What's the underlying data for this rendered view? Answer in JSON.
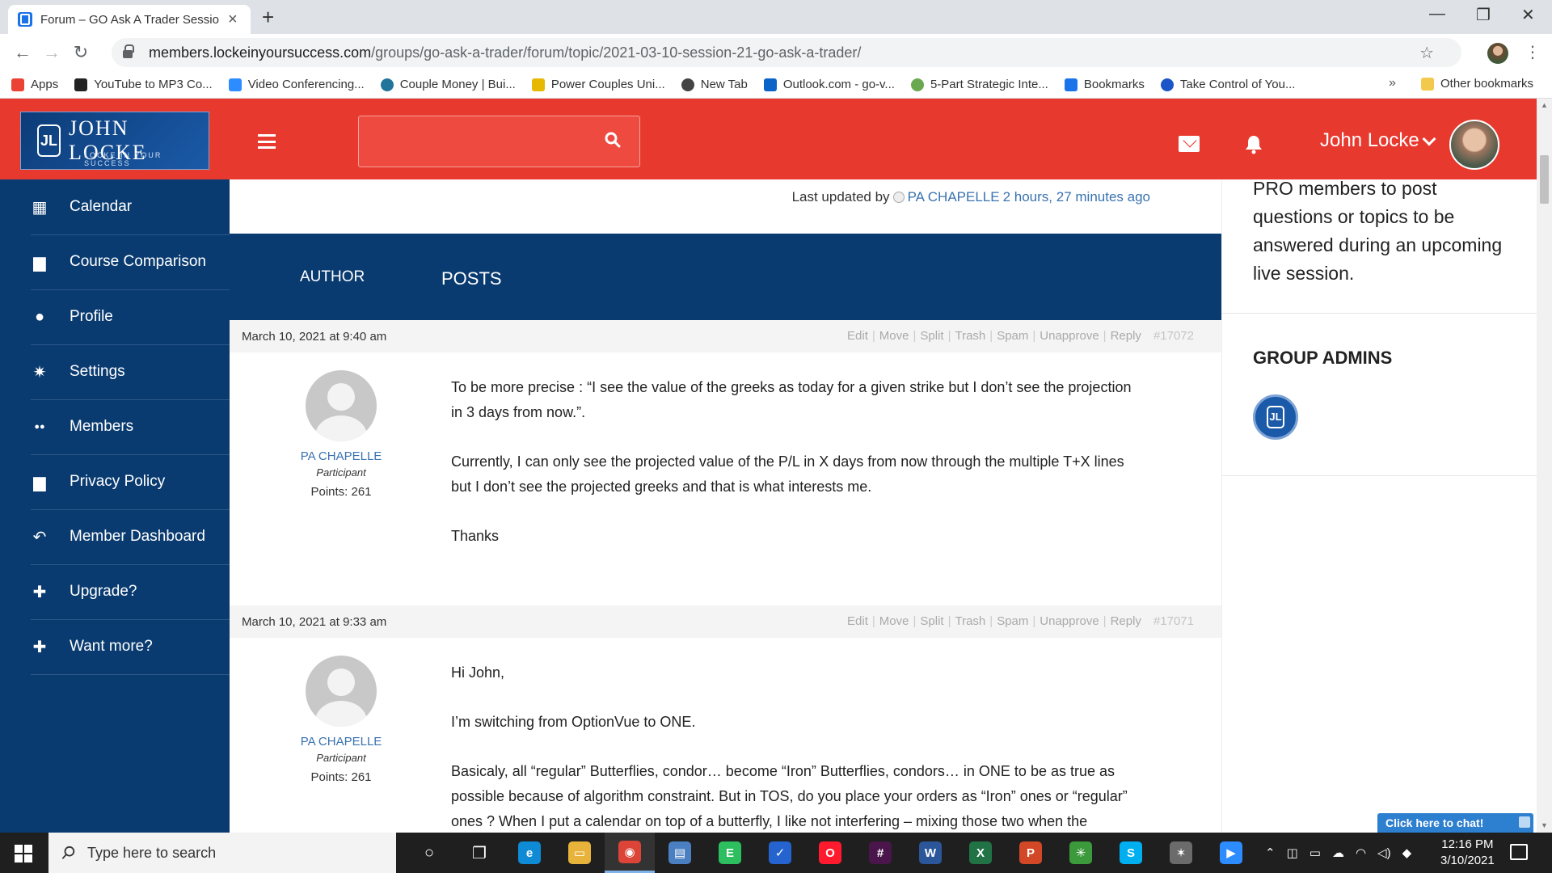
{
  "browser": {
    "tab_title": "Forum – GO Ask A Trader Sessio",
    "url_host": "members.lockeinyoursuccess.com",
    "url_path": "/groups/go-ask-a-trader/forum/topic/2021-03-10-session-21-go-ask-a-trader/",
    "bookmarks": [
      {
        "label": "Apps",
        "icon": "apps-grid-icon",
        "color": "#ea4335"
      },
      {
        "label": "YouTube to MP3 Co...",
        "icon": "music-note-icon",
        "color": "#222222"
      },
      {
        "label": "Video Conferencing...",
        "icon": "zoom-icon",
        "color": "#2d8cff"
      },
      {
        "label": "Couple Money | Bui...",
        "icon": "wordpress-icon",
        "color": "#21759b"
      },
      {
        "label": "Power Couples Uni...",
        "icon": "bookmark-page-icon",
        "color": "#e6b800"
      },
      {
        "label": "New Tab",
        "icon": "globe-icon",
        "color": "#444444"
      },
      {
        "label": "Outlook.com - go-v...",
        "icon": "outlook-icon",
        "color": "#0a64c8"
      },
      {
        "label": "5-Part Strategic Inte...",
        "icon": "circle-logo-icon",
        "color": "#6aa84f"
      },
      {
        "label": "Bookmarks",
        "icon": "star-icon",
        "color": "#1a73e8"
      },
      {
        "label": "Take Control of You...",
        "icon": "swirl-logo-icon",
        "color": "#1a56c8"
      }
    ],
    "more_label": "»",
    "other_bookmarks": "Other bookmarks"
  },
  "header": {
    "logo_text": "JOHN LOCKE",
    "logo_tagline": "LOCKE IN YOUR SUCCESS",
    "user_name": "John Locke",
    "brand_color": "#e8392f"
  },
  "sidebar": {
    "items": [
      {
        "label": "Calendar",
        "icon": "calendar-icon"
      },
      {
        "label": "Course Comparison",
        "icon": "document-icon"
      },
      {
        "label": "Profile",
        "icon": "person-icon"
      },
      {
        "label": "Settings",
        "icon": "gears-icon"
      },
      {
        "label": "Members",
        "icon": "group-icon"
      },
      {
        "label": "Privacy Policy",
        "icon": "document-icon"
      },
      {
        "label": "Member Dashboard",
        "icon": "reply-arrow-icon"
      },
      {
        "label": "Upgrade?",
        "icon": "plus-icon"
      },
      {
        "label": "Want more?",
        "icon": "plus-icon"
      }
    ]
  },
  "topic": {
    "last_updated_prefix": "Last updated by",
    "last_updated_user": "PA CHAPELLE",
    "last_updated_time": "2 hours, 27 minutes ago",
    "col_author": "AUTHOR",
    "col_posts": "POSTS"
  },
  "post_actions": [
    "Edit",
    "Move",
    "Split",
    "Trash",
    "Spam",
    "Unapprove",
    "Reply"
  ],
  "posts": [
    {
      "date": "March 10, 2021 at 9:40 am",
      "id": "#17072",
      "author": "PA CHAPELLE",
      "role": "Participant",
      "points": "Points: 261",
      "paragraphs": [
        "To be more precise : “I see the value of the greeks as today for a given strike but I don’t see the projection in 3 days from now.”.",
        "Currently, I can only see the projected value of the P/L in X days from now through the multiple T+X lines but I don’t see the projected greeks and that is what interests me.",
        "Thanks"
      ]
    },
    {
      "date": "March 10, 2021 at 9:33 am",
      "id": "#17071",
      "author": "PA CHAPELLE",
      "role": "Participant",
      "points": "Points: 261",
      "paragraphs": [
        "Hi John,",
        "I’m switching from OptionVue to ONE.",
        "Basicaly, all “regular” Butterflies, condor… become “Iron” Butterflies, condors… in ONE to be as true as possible because of algorithm constraint. But in TOS, do you place your orders as “Iron” ones or “regular” ones ? When I put a calendar on top of a butterfly, I like not interfering – mixing those two when the"
      ]
    }
  ],
  "right_panel": {
    "intro_text": "PRO members to post questions or topics to be answered during an upcoming live session.",
    "admins_heading": "GROUP ADMINS"
  },
  "chat": {
    "label": "Click here to chat!"
  },
  "taskbar": {
    "search_placeholder": "Type here to search",
    "apps": [
      {
        "name": "cortana-icon",
        "color": "#1f1f1f",
        "glyph": "○"
      },
      {
        "name": "task-view-icon",
        "color": "#1f1f1f",
        "glyph": "❐"
      },
      {
        "name": "edge-icon",
        "color": "#0f8bd6",
        "glyph": "e"
      },
      {
        "name": "file-explorer-icon",
        "color": "#e8b33a",
        "glyph": "▭"
      },
      {
        "name": "chrome-icon",
        "color": "#db4437",
        "glyph": "◉"
      },
      {
        "name": "notepad-app-icon",
        "color": "#4a7fc1",
        "glyph": "▤"
      },
      {
        "name": "evernote-icon",
        "color": "#2dbe60",
        "glyph": "E"
      },
      {
        "name": "todo-icon",
        "color": "#2564cf",
        "glyph": "✓"
      },
      {
        "name": "opera-icon",
        "color": "#ff1b2d",
        "glyph": "O"
      },
      {
        "name": "slack-icon",
        "color": "#4a154b",
        "glyph": "#"
      },
      {
        "name": "word-icon",
        "color": "#2b579a",
        "glyph": "W"
      },
      {
        "name": "excel-icon",
        "color": "#217346",
        "glyph": "X"
      },
      {
        "name": "powerpoint-icon",
        "color": "#d24726",
        "glyph": "P"
      },
      {
        "name": "greenshot-icon",
        "color": "#3c9a3c",
        "glyph": "✳"
      },
      {
        "name": "skype-icon",
        "color": "#00aff0",
        "glyph": "S"
      },
      {
        "name": "thinkorswim-icon",
        "color": "#6b6b6b",
        "glyph": "✶"
      },
      {
        "name": "zoom-icon",
        "color": "#2d8cff",
        "glyph": "▶"
      }
    ],
    "time": "12:16 PM",
    "date": "3/10/2021"
  }
}
